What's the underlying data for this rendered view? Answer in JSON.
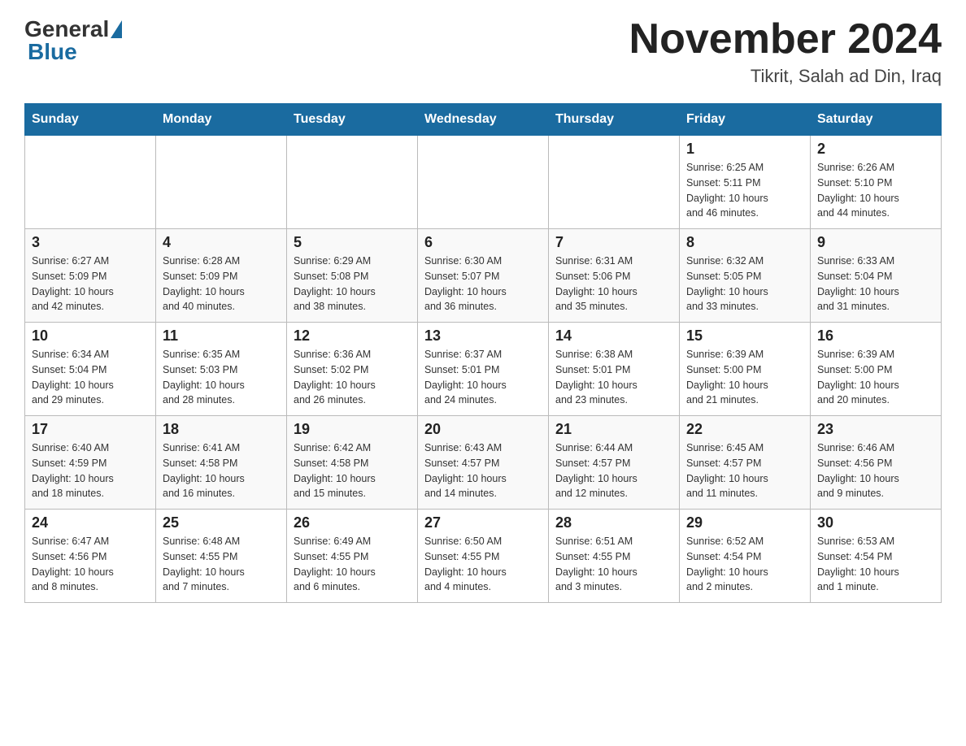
{
  "header": {
    "logo_general": "General",
    "logo_blue": "Blue",
    "month_title": "November 2024",
    "location": "Tikrit, Salah ad Din, Iraq"
  },
  "days_of_week": [
    "Sunday",
    "Monday",
    "Tuesday",
    "Wednesday",
    "Thursday",
    "Friday",
    "Saturday"
  ],
  "weeks": [
    [
      {
        "day": "",
        "info": ""
      },
      {
        "day": "",
        "info": ""
      },
      {
        "day": "",
        "info": ""
      },
      {
        "day": "",
        "info": ""
      },
      {
        "day": "",
        "info": ""
      },
      {
        "day": "1",
        "info": "Sunrise: 6:25 AM\nSunset: 5:11 PM\nDaylight: 10 hours\nand 46 minutes."
      },
      {
        "day": "2",
        "info": "Sunrise: 6:26 AM\nSunset: 5:10 PM\nDaylight: 10 hours\nand 44 minutes."
      }
    ],
    [
      {
        "day": "3",
        "info": "Sunrise: 6:27 AM\nSunset: 5:09 PM\nDaylight: 10 hours\nand 42 minutes."
      },
      {
        "day": "4",
        "info": "Sunrise: 6:28 AM\nSunset: 5:09 PM\nDaylight: 10 hours\nand 40 minutes."
      },
      {
        "day": "5",
        "info": "Sunrise: 6:29 AM\nSunset: 5:08 PM\nDaylight: 10 hours\nand 38 minutes."
      },
      {
        "day": "6",
        "info": "Sunrise: 6:30 AM\nSunset: 5:07 PM\nDaylight: 10 hours\nand 36 minutes."
      },
      {
        "day": "7",
        "info": "Sunrise: 6:31 AM\nSunset: 5:06 PM\nDaylight: 10 hours\nand 35 minutes."
      },
      {
        "day": "8",
        "info": "Sunrise: 6:32 AM\nSunset: 5:05 PM\nDaylight: 10 hours\nand 33 minutes."
      },
      {
        "day": "9",
        "info": "Sunrise: 6:33 AM\nSunset: 5:04 PM\nDaylight: 10 hours\nand 31 minutes."
      }
    ],
    [
      {
        "day": "10",
        "info": "Sunrise: 6:34 AM\nSunset: 5:04 PM\nDaylight: 10 hours\nand 29 minutes."
      },
      {
        "day": "11",
        "info": "Sunrise: 6:35 AM\nSunset: 5:03 PM\nDaylight: 10 hours\nand 28 minutes."
      },
      {
        "day": "12",
        "info": "Sunrise: 6:36 AM\nSunset: 5:02 PM\nDaylight: 10 hours\nand 26 minutes."
      },
      {
        "day": "13",
        "info": "Sunrise: 6:37 AM\nSunset: 5:01 PM\nDaylight: 10 hours\nand 24 minutes."
      },
      {
        "day": "14",
        "info": "Sunrise: 6:38 AM\nSunset: 5:01 PM\nDaylight: 10 hours\nand 23 minutes."
      },
      {
        "day": "15",
        "info": "Sunrise: 6:39 AM\nSunset: 5:00 PM\nDaylight: 10 hours\nand 21 minutes."
      },
      {
        "day": "16",
        "info": "Sunrise: 6:39 AM\nSunset: 5:00 PM\nDaylight: 10 hours\nand 20 minutes."
      }
    ],
    [
      {
        "day": "17",
        "info": "Sunrise: 6:40 AM\nSunset: 4:59 PM\nDaylight: 10 hours\nand 18 minutes."
      },
      {
        "day": "18",
        "info": "Sunrise: 6:41 AM\nSunset: 4:58 PM\nDaylight: 10 hours\nand 16 minutes."
      },
      {
        "day": "19",
        "info": "Sunrise: 6:42 AM\nSunset: 4:58 PM\nDaylight: 10 hours\nand 15 minutes."
      },
      {
        "day": "20",
        "info": "Sunrise: 6:43 AM\nSunset: 4:57 PM\nDaylight: 10 hours\nand 14 minutes."
      },
      {
        "day": "21",
        "info": "Sunrise: 6:44 AM\nSunset: 4:57 PM\nDaylight: 10 hours\nand 12 minutes."
      },
      {
        "day": "22",
        "info": "Sunrise: 6:45 AM\nSunset: 4:57 PM\nDaylight: 10 hours\nand 11 minutes."
      },
      {
        "day": "23",
        "info": "Sunrise: 6:46 AM\nSunset: 4:56 PM\nDaylight: 10 hours\nand 9 minutes."
      }
    ],
    [
      {
        "day": "24",
        "info": "Sunrise: 6:47 AM\nSunset: 4:56 PM\nDaylight: 10 hours\nand 8 minutes."
      },
      {
        "day": "25",
        "info": "Sunrise: 6:48 AM\nSunset: 4:55 PM\nDaylight: 10 hours\nand 7 minutes."
      },
      {
        "day": "26",
        "info": "Sunrise: 6:49 AM\nSunset: 4:55 PM\nDaylight: 10 hours\nand 6 minutes."
      },
      {
        "day": "27",
        "info": "Sunrise: 6:50 AM\nSunset: 4:55 PM\nDaylight: 10 hours\nand 4 minutes."
      },
      {
        "day": "28",
        "info": "Sunrise: 6:51 AM\nSunset: 4:55 PM\nDaylight: 10 hours\nand 3 minutes."
      },
      {
        "day": "29",
        "info": "Sunrise: 6:52 AM\nSunset: 4:54 PM\nDaylight: 10 hours\nand 2 minutes."
      },
      {
        "day": "30",
        "info": "Sunrise: 6:53 AM\nSunset: 4:54 PM\nDaylight: 10 hours\nand 1 minute."
      }
    ]
  ]
}
